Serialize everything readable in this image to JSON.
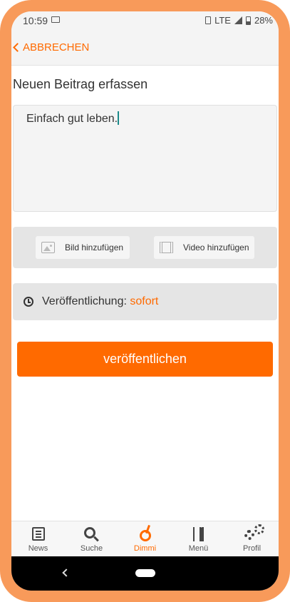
{
  "status_bar": {
    "time": "10:59",
    "network": "LTE",
    "battery": "28%"
  },
  "header": {
    "cancel_label": "ABBRECHEN"
  },
  "page": {
    "title": "Neuen Beitrag erfassen"
  },
  "editor": {
    "text": "Einfach gut leben."
  },
  "media": {
    "image_label": "Bild hinzufügen",
    "video_label": "Video hinzufügen"
  },
  "publication": {
    "label": "Veröffentlichung:",
    "value": "sofort"
  },
  "publish_button": {
    "label": "veröffentlichen"
  },
  "tabs": [
    {
      "label": "News",
      "icon": "news-icon",
      "active": false
    },
    {
      "label": "Suche",
      "icon": "search-icon",
      "active": false
    },
    {
      "label": "Dimmi",
      "icon": "dimmi-icon",
      "active": true
    },
    {
      "label": "Menü",
      "icon": "menu-icon",
      "active": false
    },
    {
      "label": "Profil",
      "icon": "gear-icon",
      "active": false
    }
  ],
  "colors": {
    "accent": "#ff6a00",
    "frame": "#f89a5a"
  }
}
